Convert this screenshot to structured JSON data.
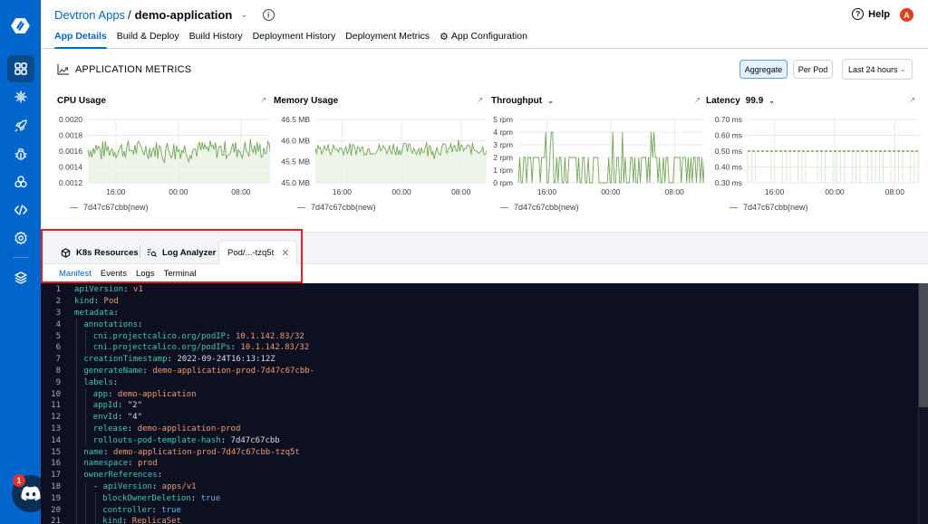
{
  "header": {
    "breadcrumb_root": "Devtron Apps",
    "breadcrumb_sep": "/",
    "app_name": "demo-application",
    "tabs": [
      {
        "label": "App Details",
        "active": true
      },
      {
        "label": "Build & Deploy"
      },
      {
        "label": "Build History"
      },
      {
        "label": "Deployment History"
      },
      {
        "label": "Deployment Metrics"
      },
      {
        "label": "App Configuration",
        "icon": "gear-icon"
      }
    ],
    "help_label": "Help",
    "avatar_initial": "A"
  },
  "sidebar": {
    "items": [
      "apps-grid-icon",
      "chart-store-icon",
      "deploy-rocket-icon",
      "security-bug-icon",
      "clusters-icon",
      "code-icon",
      "global-config-icon",
      "stack-layers-icon"
    ],
    "discord_badge": "1"
  },
  "metrics": {
    "title": "APPLICATION METRICS",
    "aggregate_label": "Aggregate",
    "per_pod_label": "Per Pod",
    "time_range": "Last 24 hours"
  },
  "chart_data": [
    {
      "type": "area",
      "title": "CPU Usage",
      "yticks": [
        "0.0020",
        "0.0018",
        "0.0016",
        "0.0014",
        "0.0012"
      ],
      "ylim": [
        0.0012,
        0.002
      ],
      "xticks": [
        "16:00",
        "00:00",
        "08:00"
      ],
      "legend": "7d47c67cbb(new)",
      "baseline": 0.00162,
      "noise": 0.00012
    },
    {
      "type": "area",
      "title": "Memory Usage",
      "yticks": [
        "46.5 MB",
        "46.0 MB",
        "45.5 MB",
        "45.0 MB"
      ],
      "ylim": [
        45.0,
        46.5
      ],
      "xticks": [
        "16:00",
        "00:00",
        "08:00"
      ],
      "legend": "7d47c67cbb(new)",
      "baseline": 45.8,
      "noise": 0.15
    },
    {
      "type": "line",
      "title": "Throughput",
      "has_dropdown": true,
      "yticks": [
        "5 rpm",
        "4 rpm",
        "3 rpm",
        "2 rpm",
        "1 rpm",
        "0 rpm"
      ],
      "ylim": [
        0,
        5
      ],
      "xticks": [
        "16:00",
        "00:00",
        "08:00"
      ],
      "legend": "7d47c67cbb(new)",
      "levels": [
        0,
        2,
        4
      ]
    },
    {
      "type": "line",
      "title": "Latency",
      "percentile": "99.9",
      "has_dropdown": true,
      "yticks": [
        "0.70 ms",
        "0.60 ms",
        "0.50 ms",
        "0.40 ms",
        "0.30 ms"
      ],
      "ylim": [
        0.3,
        0.7
      ],
      "xticks": [
        "16:00",
        "00:00",
        "08:00"
      ],
      "legend": "7d47c67cbb(new)",
      "baseline": 0.5
    }
  ],
  "resource_tabs": {
    "k8s_label": "K8s Resources",
    "log_label": "Log Analyzer",
    "pod_label": "Pod/...-tzq5t",
    "subtabs": [
      "Manifest",
      "Events",
      "Logs",
      "Terminal"
    ]
  },
  "manifest": [
    {
      "n": "1",
      "indent": 0,
      "key": "apiVersion",
      "val": "v1",
      "t": "s"
    },
    {
      "n": "2",
      "indent": 0,
      "key": "kind",
      "val": "Pod",
      "t": "s"
    },
    {
      "n": "3",
      "indent": 0,
      "key": "metadata",
      "val": "",
      "t": ""
    },
    {
      "n": "4",
      "indent": 1,
      "key": "annotations",
      "val": "",
      "t": ""
    },
    {
      "n": "5",
      "indent": 2,
      "key": "cni.projectcalico.org/podIP",
      "val": "10.1.142.83/32",
      "t": "s"
    },
    {
      "n": "6",
      "indent": 2,
      "key": "cni.projectcalico.org/podIPs",
      "val": "10.1.142.83/32",
      "t": "s"
    },
    {
      "n": "7",
      "indent": 1,
      "key": "creationTimestamp",
      "val": "2022-09-24T16:13:12Z",
      "t": "p"
    },
    {
      "n": "8",
      "indent": 1,
      "key": "generateName",
      "val": "demo-application-prod-7d47c67cbb-",
      "t": "s"
    },
    {
      "n": "9",
      "indent": 1,
      "key": "labels",
      "val": "",
      "t": ""
    },
    {
      "n": "10",
      "indent": 2,
      "key": "app",
      "val": "demo-application",
      "t": "s"
    },
    {
      "n": "11",
      "indent": 2,
      "key": "appId",
      "val": "\"2\"",
      "t": "p"
    },
    {
      "n": "12",
      "indent": 2,
      "key": "envId",
      "val": "\"4\"",
      "t": "p"
    },
    {
      "n": "13",
      "indent": 2,
      "key": "release",
      "val": "demo-application-prod",
      "t": "s"
    },
    {
      "n": "14",
      "indent": 2,
      "key": "rollouts-pod-template-hash",
      "val": "7d47c67cbb",
      "t": "p"
    },
    {
      "n": "15",
      "indent": 1,
      "key": "name",
      "val": "demo-application-prod-7d47c67cbb-tzq5t",
      "t": "s"
    },
    {
      "n": "16",
      "indent": 1,
      "key": "namespace",
      "val": "prod",
      "t": "s"
    },
    {
      "n": "17",
      "indent": 1,
      "key": "ownerReferences",
      "val": "",
      "t": ""
    },
    {
      "n": "18",
      "indent": 2,
      "dash": true,
      "key": "apiVersion",
      "val": "apps/v1",
      "t": "s"
    },
    {
      "n": "19",
      "indent": 3,
      "key": "blockOwnerDeletion",
      "val": "true",
      "t": "b"
    },
    {
      "n": "20",
      "indent": 3,
      "key": "controller",
      "val": "true",
      "t": "b"
    },
    {
      "n": "21",
      "indent": 3,
      "key": "kind",
      "val": "ReplicaSet",
      "t": "s"
    }
  ]
}
